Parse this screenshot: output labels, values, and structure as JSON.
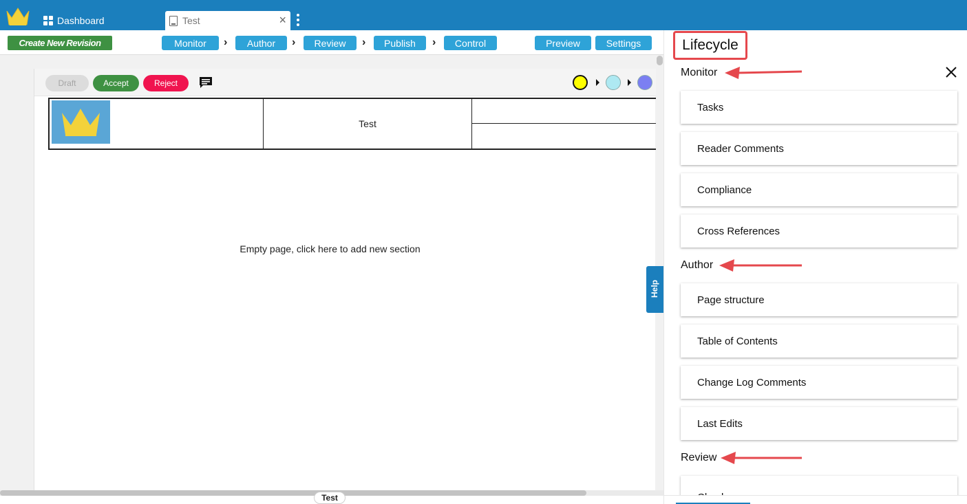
{
  "topbar": {
    "dashboard_label": "Dashboard",
    "tab_label": "Test",
    "tab_close": "×"
  },
  "toolbar": {
    "create_label": "Create New Revision",
    "steps": [
      "Monitor",
      "Author",
      "Review",
      "Publish",
      "Control"
    ],
    "preview_label": "Preview",
    "settings_label": "Settings"
  },
  "status": {
    "draft_label": "Draft",
    "accept_label": "Accept",
    "reject_label": "Reject",
    "circles": [
      "#ffff00",
      "#aee9f2",
      "#7b7ff2"
    ]
  },
  "document": {
    "header_title": "Test",
    "empty_message": "Empty page, click here to add new section",
    "help_label": "Help",
    "page_tab": "Test"
  },
  "panel": {
    "title": "Lifecycle",
    "sections": [
      {
        "label": "Monitor",
        "items": [
          "Tasks",
          "Reader Comments",
          "Compliance",
          "Cross References"
        ]
      },
      {
        "label": "Author",
        "items": [
          "Page structure",
          "Table of Contents",
          "Change Log Comments",
          "Last Edits"
        ]
      },
      {
        "label": "Review",
        "items": [
          "Check"
        ]
      }
    ]
  },
  "colors": {
    "topbar": "#1b7fbd",
    "step_pill": "#2ea3d8",
    "accept": "#3e9142",
    "reject": "#f0144f",
    "annotation": "#e5484d"
  }
}
